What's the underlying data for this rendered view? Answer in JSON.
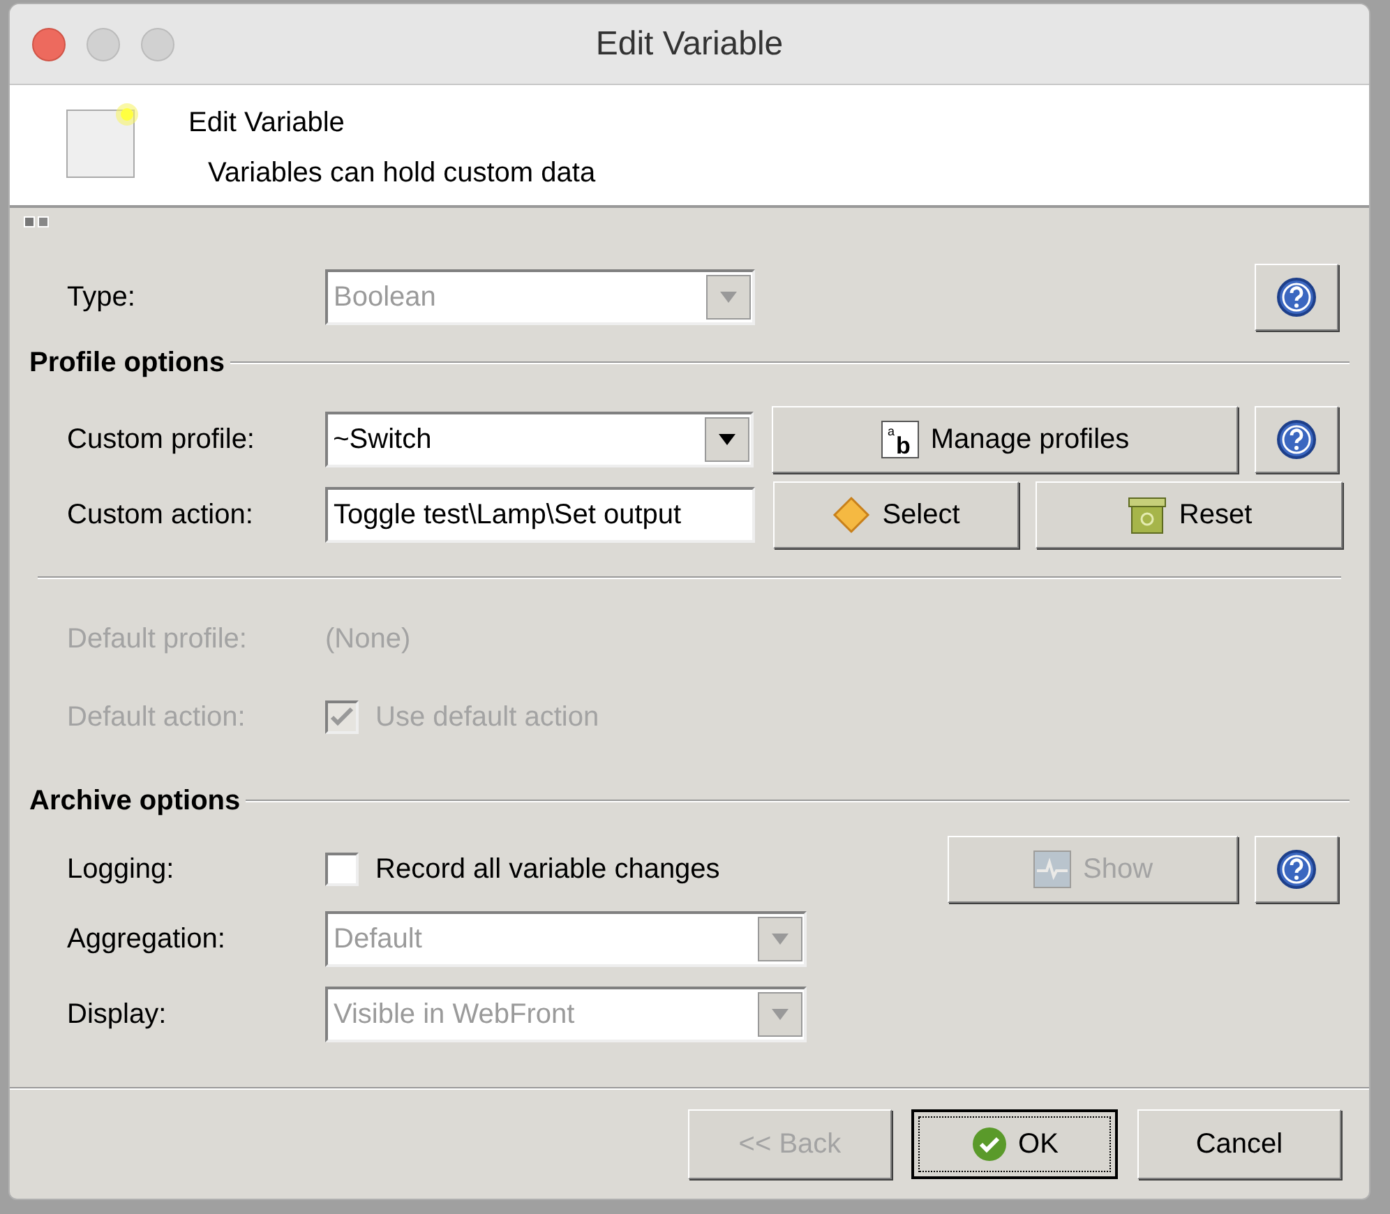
{
  "window": {
    "title": "Edit Variable"
  },
  "header": {
    "title": "Edit Variable",
    "subtitle": "Variables can hold custom data"
  },
  "type_row": {
    "label": "Type:",
    "value": "Boolean",
    "disabled": true
  },
  "profile_options": {
    "heading": "Profile options",
    "custom_profile": {
      "label": "Custom profile:",
      "value": "~Switch",
      "disabled": false
    },
    "manage_button": {
      "label": "Manage profiles",
      "disabled": false,
      "icon_letters": [
        "a",
        "b"
      ]
    },
    "custom_action": {
      "label": "Custom action:",
      "value": "Toggle test\\Lamp\\Set output"
    },
    "select_button": {
      "label": "Select",
      "disabled": false
    },
    "reset_button": {
      "label": "Reset",
      "disabled": false
    },
    "default_profile": {
      "label": "Default profile:",
      "value": "(None)",
      "disabled": true
    },
    "default_action": {
      "label": "Default action:",
      "checkbox_label": "Use default action",
      "checked": true,
      "disabled": true
    }
  },
  "archive_options": {
    "heading": "Archive options",
    "logging": {
      "label": "Logging:",
      "checkbox_label": "Record all variable changes",
      "checked": false,
      "disabled": false
    },
    "show_button": {
      "label": "Show",
      "disabled": true
    },
    "aggregation": {
      "label": "Aggregation:",
      "value": "Default",
      "disabled": true
    },
    "display": {
      "label": "Display:",
      "value": "Visible in WebFront",
      "disabled": true
    }
  },
  "footer_buttons": [
    {
      "label": "<< Back",
      "disabled": true,
      "default": false,
      "kind": "back"
    },
    {
      "label": "OK",
      "disabled": false,
      "default": true,
      "kind": "ok"
    },
    {
      "label": "Cancel",
      "disabled": false,
      "default": false,
      "kind": "cancel"
    }
  ]
}
